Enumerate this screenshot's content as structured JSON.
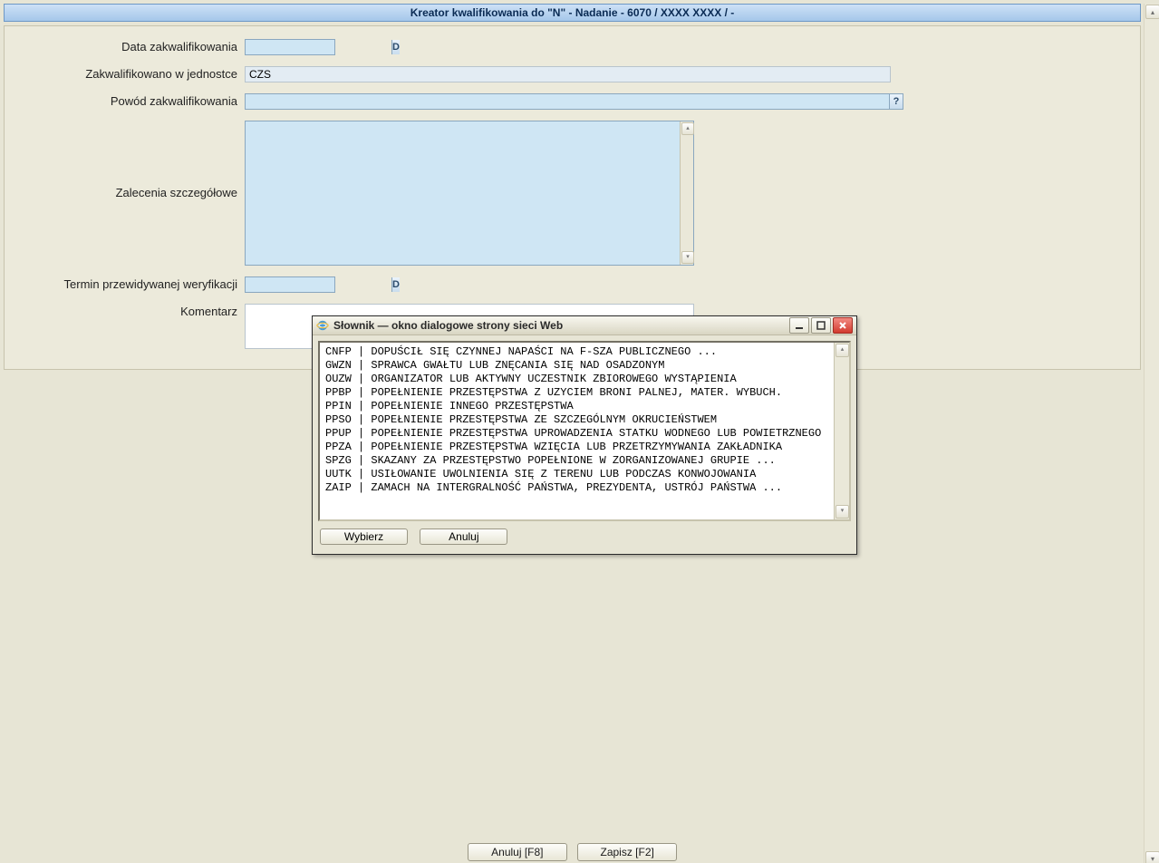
{
  "header": {
    "title": "Kreator kwalifikowania do \"N\" - Nadanie - 6070 / XXXX XXXX / -"
  },
  "form": {
    "data_zakwalifikowania": {
      "label": "Data zakwalifikowania",
      "value": "",
      "btn": "D"
    },
    "zakwalifikowano_w_jednostce": {
      "label": "Zakwalifikowano w jednostce",
      "value": "CZS"
    },
    "powod_zakwalifikowania": {
      "label": "Powód zakwalifikowania",
      "value": "",
      "btn": "?"
    },
    "zalecenia_szczegolowe": {
      "label": "Zalecenia szczegółowe",
      "value": ""
    },
    "termin_weryfikacji": {
      "label": "Termin przewidywanej weryfikacji",
      "value": "",
      "btn": "D"
    },
    "komentarz": {
      "label": "Komentarz",
      "value": ""
    }
  },
  "bottom": {
    "cancel": "Anuluj [F8]",
    "save": "Zapisz [F2]"
  },
  "dialog": {
    "title": "Słownik — okno dialogowe strony sieci Web",
    "items": [
      {
        "code": "CNFP",
        "desc": "DOPUŚCIŁ SIĘ CZYNNEJ NAPAŚCI NA F-SZA PUBLICZNEGO ..."
      },
      {
        "code": "GWZN",
        "desc": "SPRAWCA GWAŁTU LUB ZNĘCANIA SIĘ NAD OSADZONYM"
      },
      {
        "code": "OUZW",
        "desc": "ORGANIZATOR LUB AKTYWNY UCZESTNIK ZBIOROWEGO WYSTĄPIENIA"
      },
      {
        "code": "PPBP",
        "desc": "POPEŁNIENIE PRZESTĘPSTWA Z UZYCIEM BRONI PALNEJ, MATER. WYBUCH."
      },
      {
        "code": "PPIN",
        "desc": "POPEŁNIENIE INNEGO PRZESTĘPSTWA"
      },
      {
        "code": "PPSO",
        "desc": "POPEŁNIENIE PRZESTĘPSTWA ZE SZCZEGÓLNYM OKRUCIEŃSTWEM"
      },
      {
        "code": "PPUP",
        "desc": "POPEŁNIENIE PRZESTĘPSTWA UPROWADZENIA STATKU WODNEGO LUB POWIETRZNEGO"
      },
      {
        "code": "PPZA",
        "desc": "POPEŁNIENIE PRZESTĘPSTWA WZIĘCIA LUB PRZETRZYMYWANIA ZAKŁADNIKA"
      },
      {
        "code": "SPZG",
        "desc": "SKAZANY ZA PRZESTĘPSTWO POPEŁNIONE W ZORGANIZOWANEJ GRUPIE ..."
      },
      {
        "code": "UUTK",
        "desc": "USIŁOWANIE UWOLNIENIA SIĘ Z TERENU LUB PODCZAS KONWOJOWANIA"
      },
      {
        "code": "ZAIP",
        "desc": "ZAMACH NA INTERGRALNOŚĆ PAŃSTWA, PREZYDENTA, USTRÓJ PAŃSTWA ..."
      }
    ],
    "choose": "Wybierz",
    "cancel": "Anuluj"
  }
}
